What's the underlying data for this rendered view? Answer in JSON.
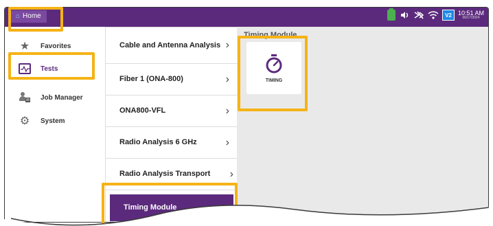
{
  "topbar": {
    "home_label": "Home",
    "time": "10:51 AM",
    "date": "06/17/2024",
    "badge": "V2",
    "icons": [
      "battery-charging-icon",
      "speaker-icon",
      "bluetooth-off-icon",
      "wifi-icon",
      "v2-badge"
    ]
  },
  "sidebar": {
    "items": [
      {
        "label": "Favorites",
        "icon": "star-icon"
      },
      {
        "label": "Tests",
        "icon": "tests-icon",
        "active": true
      },
      {
        "label": "Job Manager",
        "icon": "job-manager-icon"
      },
      {
        "label": "System",
        "icon": "gear-icon"
      }
    ]
  },
  "menu": {
    "items": [
      {
        "label": "Cable and Antenna Analysis"
      },
      {
        "label": "Fiber 1 (ONA-800)"
      },
      {
        "label": "ONA800-VFL"
      },
      {
        "label": "Radio Analysis 6 GHz"
      },
      {
        "label": "Radio Analysis Transport"
      },
      {
        "label": "Timing Module",
        "active": true
      }
    ]
  },
  "main": {
    "title": "Timing Module",
    "tile_label": "TIMING"
  },
  "colors": {
    "brand": "#5b2a7d",
    "highlight": "#f5b316"
  }
}
